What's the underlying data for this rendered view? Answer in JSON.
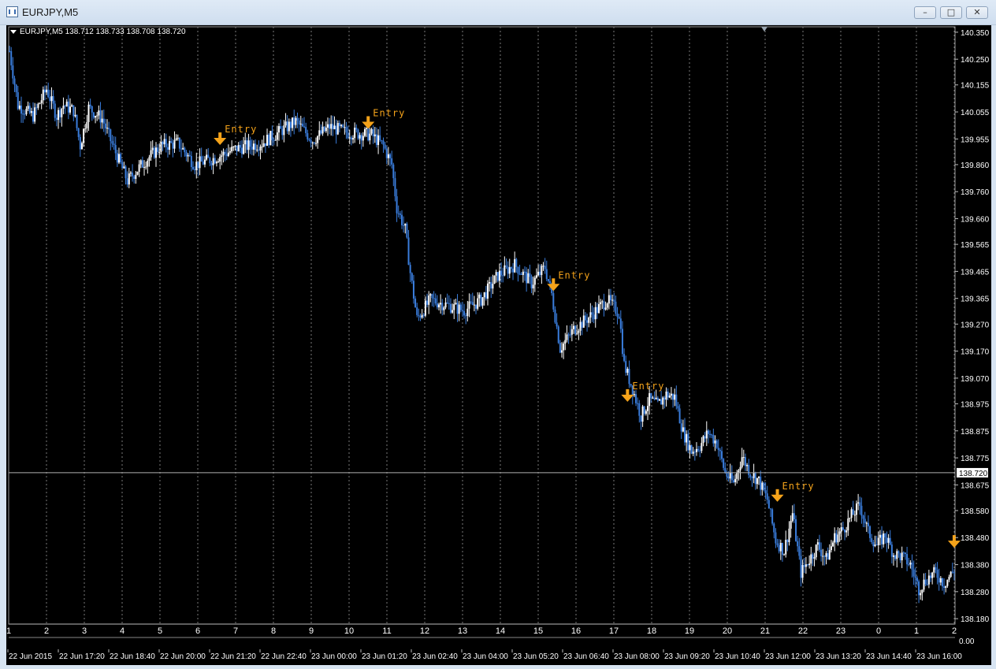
{
  "window": {
    "title": "EURJPY,M5"
  },
  "chart_info": {
    "text": "EURJPY,M5  138.712 138.733 138.708 138.720"
  },
  "colors": {
    "background": "#000000",
    "bull_candle": "#ffffff",
    "bear_candle": "#3a7ddc",
    "grid": "#7a7a7a",
    "arrow": "#f5a31a",
    "text": "#ffffff"
  },
  "price_axis": {
    "labels": [
      "140.350",
      "140.250",
      "140.155",
      "140.055",
      "139.955",
      "139.860",
      "139.760",
      "139.660",
      "139.565",
      "139.465",
      "139.365",
      "139.270",
      "139.170",
      "139.070",
      "138.975",
      "138.875",
      "138.775",
      "138.675",
      "138.580",
      "138.480",
      "138.380",
      "138.280",
      "138.180"
    ],
    "current_price_label": "138.720"
  },
  "hour_axis": {
    "labels": [
      "1",
      "2",
      "3",
      "4",
      "5",
      "6",
      "7",
      "8",
      "9",
      "10",
      "11",
      "12",
      "13",
      "14",
      "15",
      "16",
      "17",
      "18",
      "19",
      "20",
      "21",
      "22",
      "23",
      "0",
      "1",
      "2"
    ],
    "corner_label": "0.00"
  },
  "time_axis": {
    "labels": [
      "22 Jun 2015",
      "22 Jun 17:20",
      "22 Jun 18:40",
      "22 Jun 20:00",
      "22 Jun 21:20",
      "22 Jun 22:40",
      "23 Jun 00:00",
      "23 Jun 01:20",
      "23 Jun 02:40",
      "23 Jun 04:00",
      "23 Jun 05:20",
      "23 Jun 06:40",
      "23 Jun 08:00",
      "23 Jun 09:20",
      "23 Jun 10:40",
      "23 Jun 12:00",
      "23 Jun 13:20",
      "23 Jun 14:40",
      "23 Jun 16:00"
    ]
  },
  "chart_data": {
    "type": "candlestick",
    "symbol": "EURJPY",
    "timeframe": "M5",
    "ylim": [
      138.16,
      140.37
    ],
    "current_price": 138.72,
    "grid": true,
    "path_points": [
      [
        0,
        140.28
      ],
      [
        5,
        140.08
      ],
      [
        14,
        140.04
      ],
      [
        22,
        140.14
      ],
      [
        28,
        140.04
      ],
      [
        32,
        140.08
      ],
      [
        38,
        140.06
      ],
      [
        42,
        139.93
      ],
      [
        47,
        140.07
      ],
      [
        55,
        140.03
      ],
      [
        60,
        139.95
      ],
      [
        70,
        139.8
      ],
      [
        80,
        139.87
      ],
      [
        90,
        139.93
      ],
      [
        100,
        139.94
      ],
      [
        110,
        139.86
      ],
      [
        120,
        139.88
      ],
      [
        135,
        139.92
      ],
      [
        150,
        139.94
      ],
      [
        165,
        140.0
      ],
      [
        170,
        140.02
      ],
      [
        180,
        139.95
      ],
      [
        190,
        140.0
      ],
      [
        200,
        139.98
      ],
      [
        215,
        139.97
      ],
      [
        222,
        139.93
      ],
      [
        227,
        139.86
      ],
      [
        230,
        139.7
      ],
      [
        235,
        139.62
      ],
      [
        238,
        139.46
      ],
      [
        242,
        139.29
      ],
      [
        250,
        139.36
      ],
      [
        260,
        139.34
      ],
      [
        270,
        139.32
      ],
      [
        280,
        139.36
      ],
      [
        290,
        139.45
      ],
      [
        300,
        139.49
      ],
      [
        310,
        139.42
      ],
      [
        318,
        139.48
      ],
      [
        322,
        139.38
      ],
      [
        327,
        139.18
      ],
      [
        335,
        139.25
      ],
      [
        345,
        139.3
      ],
      [
        355,
        139.36
      ],
      [
        362,
        139.31
      ],
      [
        365,
        139.12
      ],
      [
        370,
        139.03
      ],
      [
        375,
        138.93
      ],
      [
        380,
        138.99
      ],
      [
        385,
        138.97
      ],
      [
        390,
        139.01
      ],
      [
        395,
        139.0
      ],
      [
        400,
        138.87
      ],
      [
        405,
        138.8
      ],
      [
        410,
        138.82
      ],
      [
        415,
        138.87
      ],
      [
        420,
        138.83
      ],
      [
        425,
        138.72
      ],
      [
        430,
        138.68
      ],
      [
        435,
        138.78
      ],
      [
        440,
        138.72
      ],
      [
        445,
        138.69
      ],
      [
        450,
        138.62
      ],
      [
        455,
        138.47
      ],
      [
        460,
        138.43
      ],
      [
        465,
        138.57
      ],
      [
        470,
        138.35
      ],
      [
        475,
        138.4
      ],
      [
        480,
        138.45
      ],
      [
        485,
        138.4
      ],
      [
        490,
        138.48
      ],
      [
        495,
        138.51
      ],
      [
        500,
        138.56
      ],
      [
        505,
        138.6
      ],
      [
        510,
        138.5
      ],
      [
        515,
        138.45
      ],
      [
        520,
        138.49
      ],
      [
        525,
        138.42
      ],
      [
        530,
        138.41
      ],
      [
        535,
        138.38
      ],
      [
        540,
        138.29
      ],
      [
        545,
        138.33
      ],
      [
        550,
        138.35
      ],
      [
        555,
        138.31
      ],
      [
        561,
        138.36
      ]
    ],
    "entry_markers": [
      {
        "x": 125,
        "price": 139.95,
        "label": "Entry"
      },
      {
        "x": 213,
        "price": 140.01,
        "label": "Entry"
      },
      {
        "x": 323,
        "price": 139.41,
        "label": "Entry"
      },
      {
        "x": 367,
        "price": 139.0,
        "label": "Entry"
      },
      {
        "x": 456,
        "price": 138.63,
        "label": "Entry"
      },
      {
        "x": 561,
        "price": 138.46,
        "label": ""
      }
    ]
  }
}
